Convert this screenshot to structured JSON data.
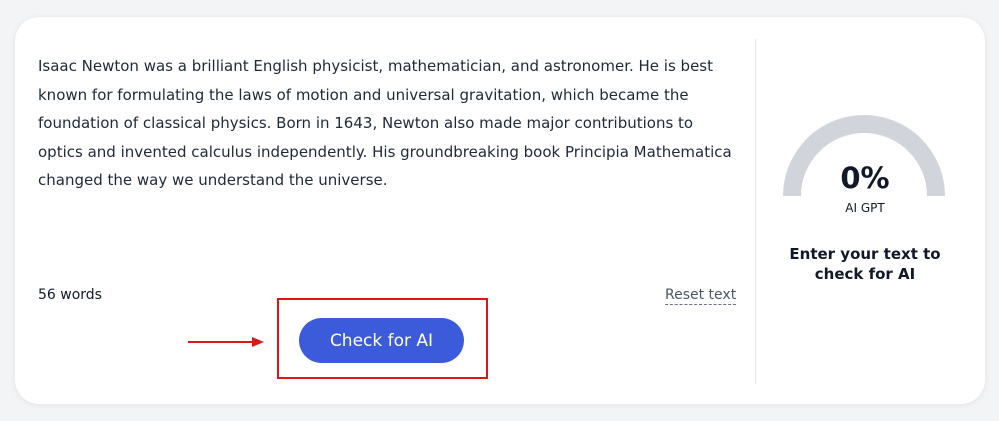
{
  "editor": {
    "text": "Isaac Newton was a brilliant English physicist, mathematician, and astronomer. He is best known for formulating the laws of motion and universal gravitation, which became the foundation of classical physics. Born in 1643, Newton also made major contributions to optics and invented calculus independently. His groundbreaking book Principia Mathematica changed the way we understand the universe.",
    "word_count": "56 words",
    "reset_label": "Reset text"
  },
  "actions": {
    "check_label": "Check for AI"
  },
  "result": {
    "percent": "0%",
    "percent_value": 0,
    "caption": "AI GPT",
    "message": "Enter your text to check for AI"
  },
  "colors": {
    "button": "#3b5bdb",
    "annotation": "#e01515",
    "gauge_track": "#d1d5db"
  },
  "icons": {
    "annotation_arrow": "arrow-right-icon"
  }
}
